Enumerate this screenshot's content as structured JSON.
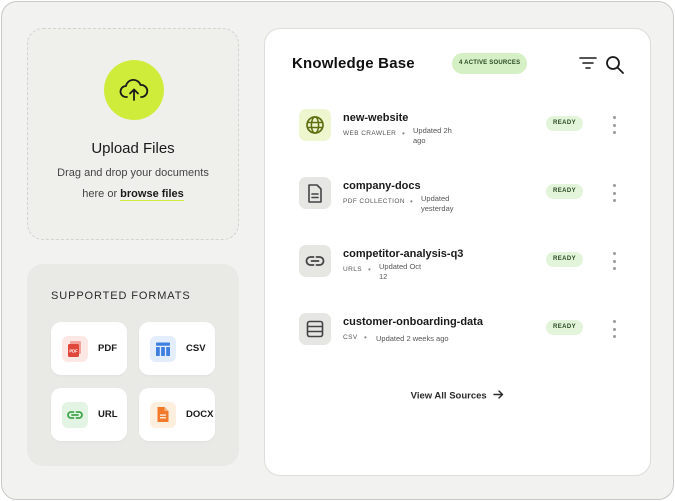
{
  "upload": {
    "title": "Upload Files",
    "desc_prefix": "Drag and drop your documents here or ",
    "browse_label": "browse files",
    "icon": "cloud-upload-icon"
  },
  "formats": {
    "title": "SUPPORTED FORMATS",
    "items": [
      {
        "label": "PDF",
        "icon": "pdf-file-icon",
        "color": "#e0463a"
      },
      {
        "label": "CSV",
        "icon": "table-icon",
        "color": "#3f7fe0"
      },
      {
        "label": "URL",
        "icon": "link-icon",
        "color": "#3fa64a"
      },
      {
        "label": "DOCX",
        "icon": "doc-file-icon",
        "color": "#f07a2a"
      }
    ]
  },
  "panel": {
    "title": "Knowledge Base",
    "active_badge": "4 ACTIVE SOURCES",
    "view_all": "View All Sources"
  },
  "sources": [
    {
      "name": "new-website",
      "type": "WEB CRAWLER",
      "updated": "Updated 2h ago",
      "status": "READY",
      "icon": "globe-icon"
    },
    {
      "name": "company-docs",
      "type": "PDF COLLECTION",
      "updated": "Updated yesterday",
      "status": "READY",
      "icon": "document-icon"
    },
    {
      "name": "competitor-analysis-q3",
      "type": "URLS",
      "updated": "Updated Oct 12",
      "status": "READY",
      "icon": "link-icon"
    },
    {
      "name": "customer-onboarding-data",
      "type": "CSV",
      "updated": "Updated 2 weeks ago",
      "status": "READY",
      "icon": "table-icon"
    }
  ],
  "colors": {
    "accent_lime": "#cfec3a",
    "ready_bg": "#e2f4d9",
    "badge_bg": "#d4f0c4",
    "text_dark": "#1a1a1a"
  }
}
